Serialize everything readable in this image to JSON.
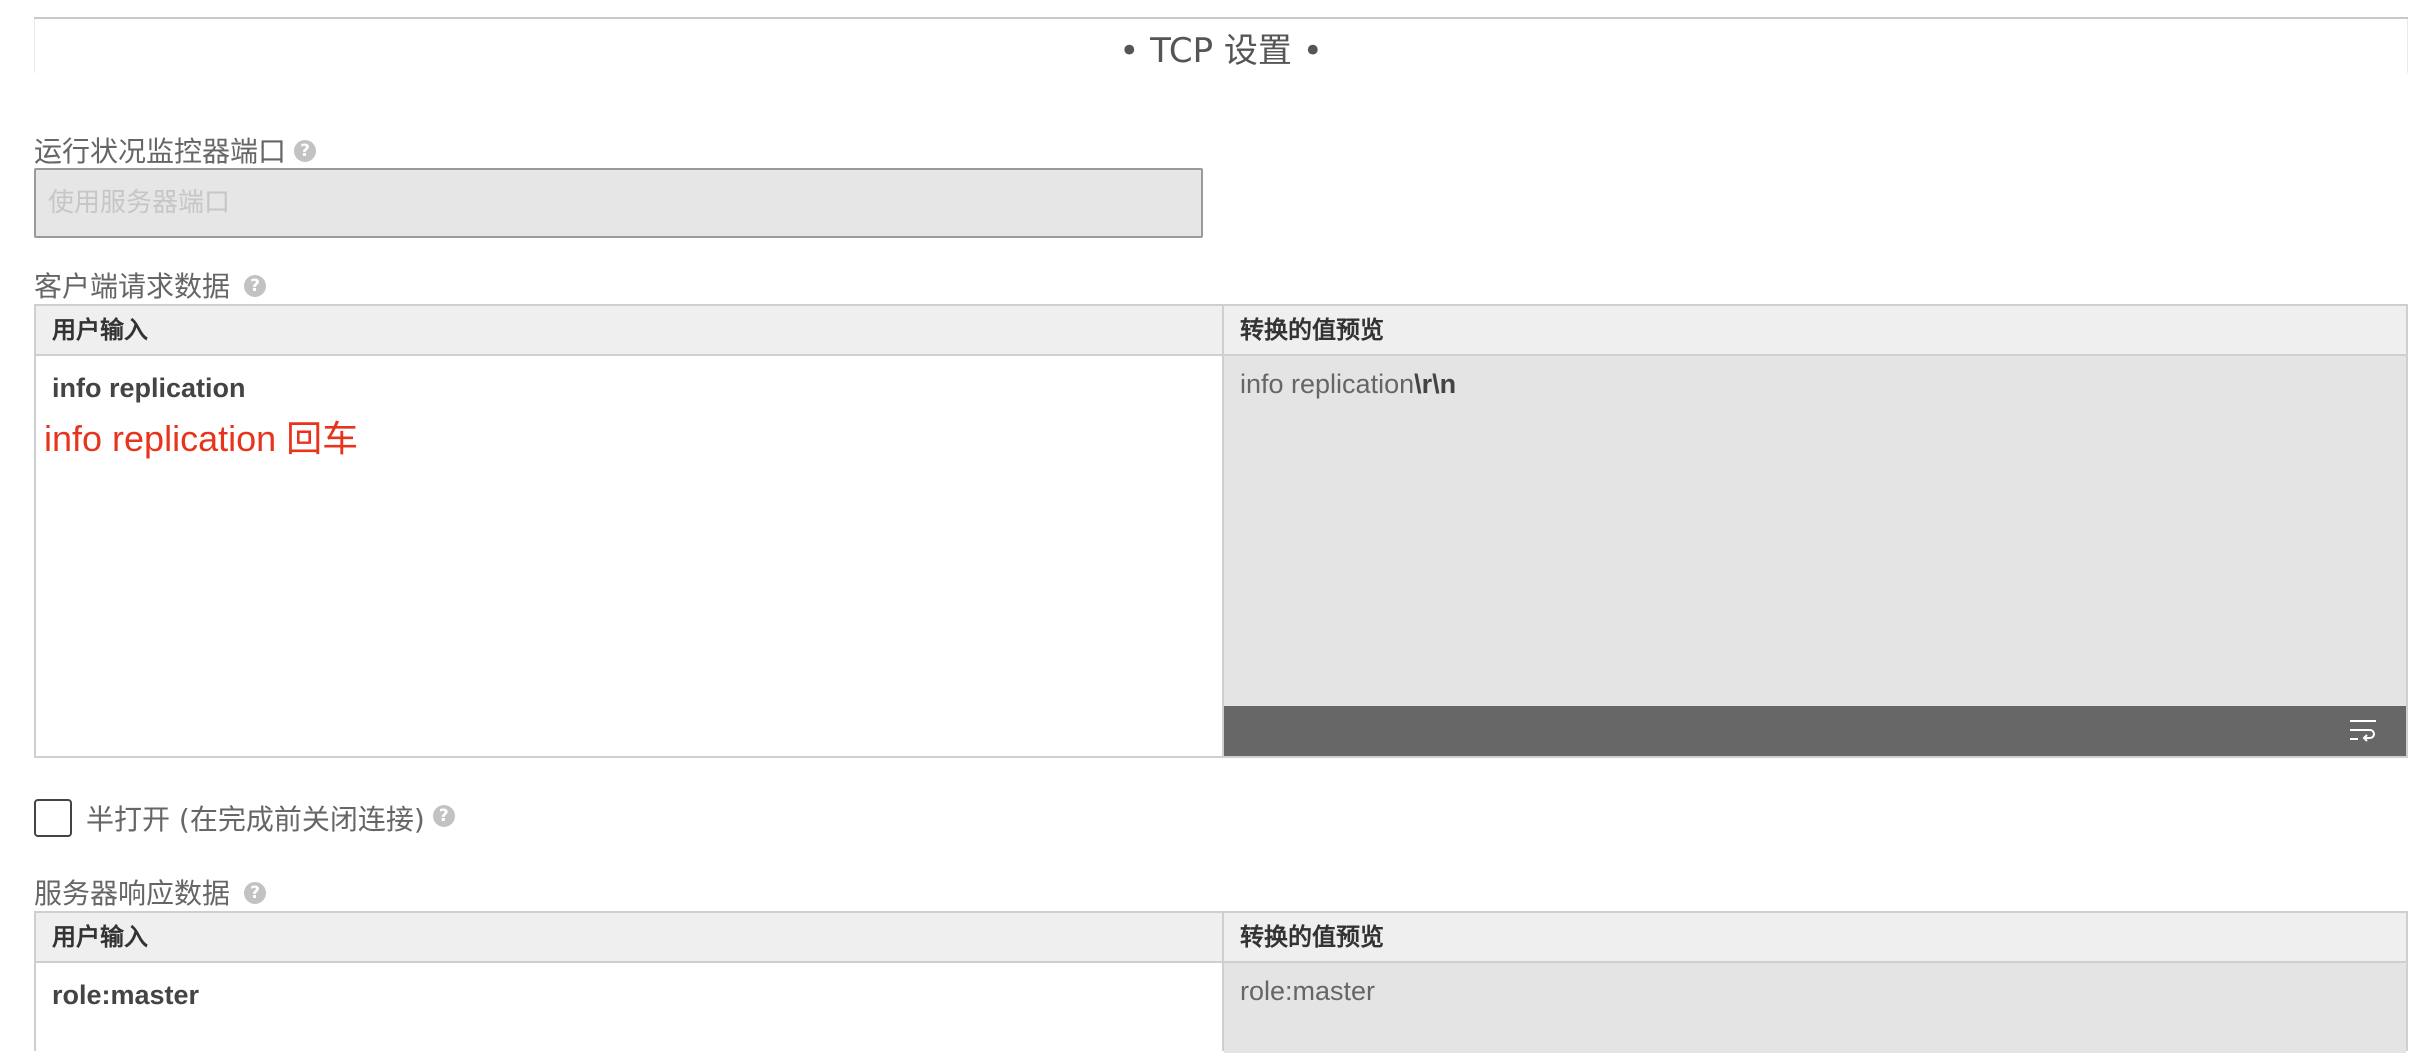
{
  "section": {
    "title": "• TCP 设置 •"
  },
  "monitor_port": {
    "label": "运行状况监控器端口",
    "placeholder": "使用服务器端口",
    "value": ""
  },
  "client_request": {
    "label": "客户端请求数据",
    "col_user_input": "用户输入",
    "col_preview": "转换的值预览",
    "user_input_value": "info replication",
    "preview_text": "info replication",
    "preview_suffix": "\\r\\n",
    "annotation": "info replication 回车"
  },
  "half_open": {
    "label": "半打开 (在完成前关闭连接)",
    "checked": false
  },
  "server_response": {
    "label": "服务器响应数据",
    "col_user_input": "用户输入",
    "col_preview": "转换的值预览",
    "user_input_value": "role:master",
    "preview_text": "role:master"
  },
  "colors": {
    "annotation_red": "#e8341c",
    "preview_bg": "#e4e4e4",
    "toolbar_bg": "#676767"
  },
  "icons": {
    "help": "question-circle-icon",
    "wrap": "wrap-lines-icon"
  }
}
